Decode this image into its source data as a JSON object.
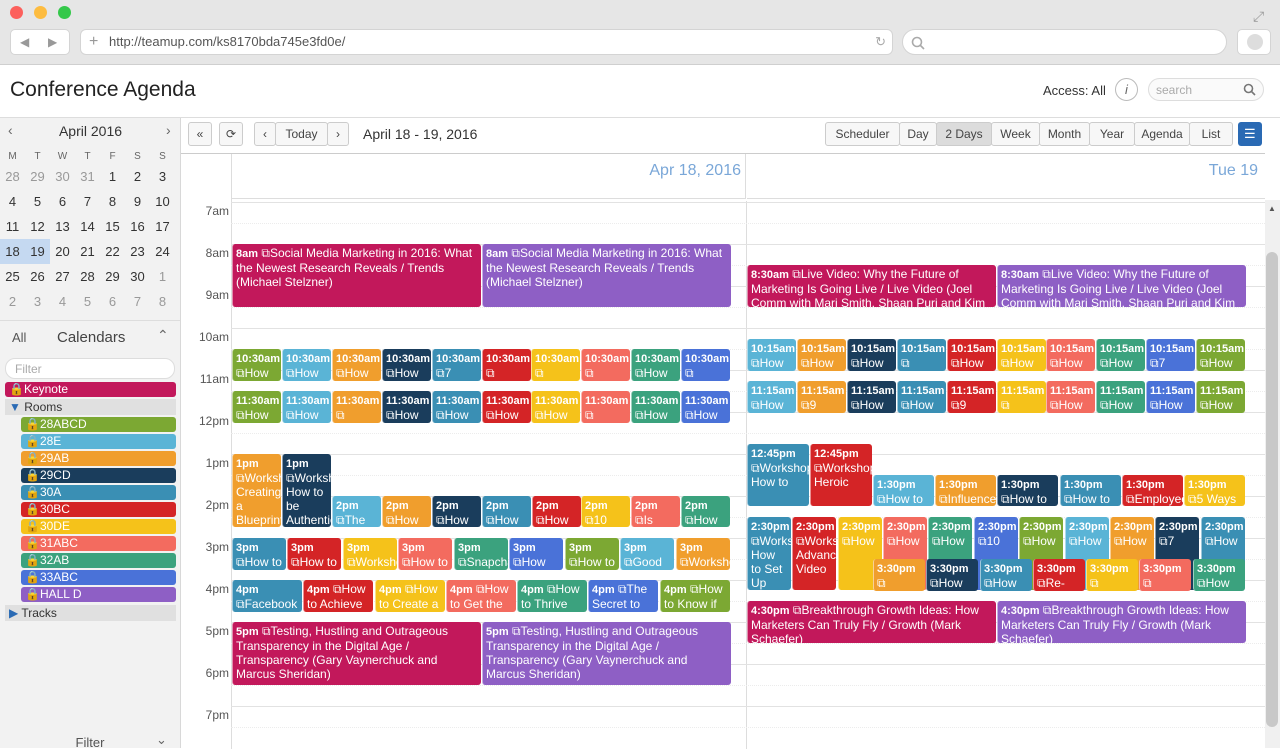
{
  "browser": {
    "url": "http://teamup.com/ks8170bda745e3fd0e/"
  },
  "app": {
    "title": "Conference Agenda",
    "access_label": "Access: All",
    "search_placeholder": "search"
  },
  "mini_calendar": {
    "month_label": "April 2016",
    "weekdays": [
      "M",
      "T",
      "W",
      "T",
      "F",
      "S",
      "S"
    ],
    "weeks": [
      [
        "28",
        "29",
        "30",
        "31",
        "1",
        "2",
        "3"
      ],
      [
        "4",
        "5",
        "6",
        "7",
        "8",
        "9",
        "10"
      ],
      [
        "11",
        "12",
        "13",
        "14",
        "15",
        "16",
        "17"
      ],
      [
        "18",
        "19",
        "20",
        "21",
        "22",
        "23",
        "24"
      ],
      [
        "25",
        "26",
        "27",
        "28",
        "29",
        "30",
        "1"
      ],
      [
        "2",
        "3",
        "4",
        "5",
        "6",
        "7",
        "8"
      ]
    ]
  },
  "sidebar": {
    "all_label": "All",
    "calendars_label": "Calendars",
    "filter_placeholder": "Filter",
    "keynote": "Keynote",
    "rooms_label": "Rooms",
    "tracks_label": "Tracks",
    "footer_filter": "Filter",
    "rooms": [
      {
        "label": "28ABCD",
        "color": "#7ca833"
      },
      {
        "label": "28E",
        "color": "#5ab4d6"
      },
      {
        "label": "29AB",
        "color": "#f09e2d"
      },
      {
        "label": "29CD",
        "color": "#1a3d5c"
      },
      {
        "label": "30A",
        "color": "#3a8fb4"
      },
      {
        "label": "30BC",
        "color": "#d42426"
      },
      {
        "label": "30DE",
        "color": "#f5c21a"
      },
      {
        "label": "31ABC",
        "color": "#f36b5f"
      },
      {
        "label": "32AB",
        "color": "#3ba27e"
      },
      {
        "label": "33ABC",
        "color": "#4a72d8"
      },
      {
        "label": "HALL D",
        "color": "#8e5fc5"
      }
    ]
  },
  "toolbar": {
    "today": "Today",
    "range": "April 18 - 19, 2016",
    "views": [
      "Scheduler",
      "Day",
      "2 Days",
      "Week",
      "Month",
      "Year",
      "Agenda",
      "List"
    ],
    "active_view": "2 Days"
  },
  "days": [
    {
      "label": "Apr 18, 2016"
    },
    {
      "label": "Tue 19"
    }
  ],
  "hours": [
    "7am",
    "8am",
    "9am",
    "10am",
    "11am",
    "12pm",
    "1pm",
    "2pm",
    "3pm",
    "4pm",
    "5pm",
    "6pm",
    "7pm"
  ],
  "events": {
    "d1_8am_a": {
      "time": "8am",
      "title": "Social Media Marketing in 2016: What the Newest Research Reveals / Trends (Michael Stelzner)"
    },
    "d1_8am_b": {
      "time": "8am",
      "title": "Social Media Marketing in 2016: What the Newest Research Reveals / Trends (Michael Stelzner)"
    },
    "d2_830_a": {
      "time": "8:30am",
      "title": "Live Video: Why the Future of Marketing Is Going Live / Live Video (Joel Comm with Mari Smith, Shaan Puri and Kim"
    },
    "d2_830_b": {
      "time": "8:30am",
      "title": "Live Video: Why the Future of Marketing Is Going Live / Live Video (Joel Comm with Mari Smith, Shaan Puri and Kim"
    },
    "d1_5pm_a": {
      "time": "5pm",
      "title": "Testing, Hustling and Outrageous Transparency in the Digital Age / Transparency (Gary Vaynerchuck and Marcus Sheridan)"
    },
    "d1_5pm_b": {
      "time": "5pm",
      "title": "Testing, Hustling and Outrageous Transparency in the Digital Age / Transparency (Gary Vaynerchuck and Marcus Sheridan)"
    },
    "d2_430_a": {
      "time": "4:30pm",
      "title": "Breakthrough Growth Ideas: How Marketers Can Truly Fly / Growth (Mark Schaefer)"
    },
    "d2_430_b": {
      "time": "4:30pm",
      "title": "Breakthrough Growth Ideas: How Marketers Can Truly Fly / Growth (Mark Schaefer)"
    }
  },
  "small_events": {
    "d1_1030": [
      {
        "t": "10:30am",
        "s": "How"
      },
      {
        "t": "10:30am",
        "s": "How"
      },
      {
        "t": "10:30am",
        "s": "How"
      },
      {
        "t": "10:30am",
        "s": "How"
      },
      {
        "t": "10:30am",
        "s": "7"
      },
      {
        "t": "10:30am",
        "s": ""
      },
      {
        "t": "10:30am",
        "s": ""
      },
      {
        "t": "10:30am",
        "s": ""
      },
      {
        "t": "10:30am",
        "s": "How"
      },
      {
        "t": "10:30am",
        "s": ""
      }
    ],
    "d1_1130": [
      {
        "t": "11:30am",
        "s": "How"
      },
      {
        "t": "11:30am",
        "s": "How"
      },
      {
        "t": "11:30am",
        "s": ""
      },
      {
        "t": "11:30am",
        "s": "How"
      },
      {
        "t": "11:30am",
        "s": "How"
      },
      {
        "t": "11:30am",
        "s": "How"
      },
      {
        "t": "11:30am",
        "s": "How"
      },
      {
        "t": "11:30am",
        "s": ""
      },
      {
        "t": "11:30am",
        "s": "How"
      },
      {
        "t": "11:30am",
        "s": "How"
      }
    ],
    "d2_1015": [
      {
        "t": "10:15am",
        "s": "How"
      },
      {
        "t": "10:15am",
        "s": "How"
      },
      {
        "t": "10:15am",
        "s": "How"
      },
      {
        "t": "10:15am",
        "s": ""
      },
      {
        "t": "10:15am",
        "s": "How"
      },
      {
        "t": "10:15am",
        "s": "How"
      },
      {
        "t": "10:15am",
        "s": "How"
      },
      {
        "t": "10:15am",
        "s": "How"
      },
      {
        "t": "10:15am",
        "s": "7"
      },
      {
        "t": "10:15am",
        "s": "How"
      }
    ],
    "d2_1115": [
      {
        "t": "11:15am",
        "s": "How"
      },
      {
        "t": "11:15am",
        "s": "9"
      },
      {
        "t": "11:15am",
        "s": "How"
      },
      {
        "t": "11:15am",
        "s": "How"
      },
      {
        "t": "11:15am",
        "s": "9"
      },
      {
        "t": "11:15am",
        "s": ""
      },
      {
        "t": "11:15am",
        "s": "How"
      },
      {
        "t": "11:15am",
        "s": "How"
      },
      {
        "t": "11:15am",
        "s": "How"
      },
      {
        "t": "11:15am",
        "s": "How"
      }
    ],
    "d1_1pm": [
      {
        "t": "1pm",
        "s": "Workshop: Creating a Blueprint"
      },
      {
        "t": "1pm",
        "s": "Workshop: How to be Authentic"
      }
    ],
    "d1_2pm": [
      {
        "t": "2pm",
        "s": "The"
      },
      {
        "t": "2pm",
        "s": "How"
      },
      {
        "t": "2pm",
        "s": "How to"
      },
      {
        "t": "2pm",
        "s": "How to"
      },
      {
        "t": "2pm",
        "s": "How"
      },
      {
        "t": "2pm",
        "s": "10"
      },
      {
        "t": "2pm",
        "s": "Is"
      },
      {
        "t": "2pm",
        "s": "How to"
      }
    ],
    "d1_3pm": [
      {
        "t": "3pm",
        "s": "How to"
      },
      {
        "t": "3pm",
        "s": "How to"
      },
      {
        "t": "3pm",
        "s": "Worksho"
      },
      {
        "t": "3pm",
        "s": "How to"
      },
      {
        "t": "3pm",
        "s": "Snapcha"
      },
      {
        "t": "3pm",
        "s": "How"
      },
      {
        "t": "3pm",
        "s": "How to"
      },
      {
        "t": "3pm",
        "s": "Good"
      },
      {
        "t": "3pm",
        "s": "Worksho"
      }
    ],
    "d1_4pm": [
      {
        "t": "4pm",
        "s": "Facebook"
      },
      {
        "t": "4pm",
        "s": "How to Achieve"
      },
      {
        "t": "4pm",
        "s": "How to Create a"
      },
      {
        "t": "4pm",
        "s": "How to Get the"
      },
      {
        "t": "4pm",
        "s": "How to Thrive"
      },
      {
        "t": "4pm",
        "s": "The Secret to"
      },
      {
        "t": "4pm",
        "s": "How to Know if"
      }
    ],
    "d2_1245": [
      {
        "t": "12:45pm",
        "s": "Workshop: How to"
      },
      {
        "t": "12:45pm",
        "s": "Workshop: Heroic"
      }
    ],
    "d2_130": [
      {
        "t": "1:30pm",
        "s": "How to"
      },
      {
        "t": "1:30pm",
        "s": "Influencer"
      },
      {
        "t": "1:30pm",
        "s": "How to"
      },
      {
        "t": "1:30pm",
        "s": "How to"
      },
      {
        "t": "1:30pm",
        "s": "Employee"
      },
      {
        "t": "1:30pm",
        "s": "5 Ways to"
      }
    ],
    "d2_230": [
      {
        "t": "2:30pm",
        "s": "Worksh How to Set Up"
      },
      {
        "t": "2:30pm",
        "s": "Worksh Advanc Video"
      },
      {
        "t": "2:30pm",
        "s": "How"
      },
      {
        "t": "2:30pm",
        "s": "How"
      },
      {
        "t": "2:30pm",
        "s": "How"
      },
      {
        "t": "2:30pm",
        "s": "10"
      },
      {
        "t": "2:30pm",
        "s": "How"
      },
      {
        "t": "2:30pm",
        "s": "How"
      },
      {
        "t": "2:30pm",
        "s": "How"
      },
      {
        "t": "2:30pm",
        "s": "7"
      },
      {
        "t": "2:30pm",
        "s": "How"
      }
    ],
    "d2_330": [
      {
        "t": "3:30pm",
        "s": ""
      },
      {
        "t": "3:30pm",
        "s": "How"
      },
      {
        "t": "3:30pm",
        "s": "How"
      },
      {
        "t": "3:30pm",
        "s": "Re-"
      },
      {
        "t": "3:30pm",
        "s": ""
      },
      {
        "t": "3:30pm",
        "s": ""
      },
      {
        "t": "3:30pm",
        "s": "How to Get People to Consume"
      }
    ]
  }
}
